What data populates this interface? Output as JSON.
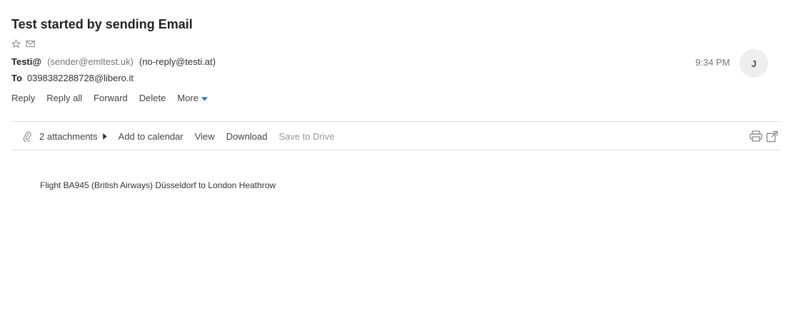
{
  "subject": "Test started by sending Email",
  "icons": {
    "star": "star-icon",
    "envelope": "envelope-icon",
    "chevron": "chevron-down-icon",
    "paperclip": "paperclip-icon",
    "triangle": "caret-right-icon",
    "print": "print-icon",
    "popout": "external-link-icon"
  },
  "from": {
    "name": "Testi@",
    "address": "(sender@emltest.uk)",
    "reply_to": "(no-reply@testi.at)"
  },
  "to": {
    "label": "To",
    "address": "0398382288728@libero.it"
  },
  "time": "9:34 PM",
  "avatar_initial": "J",
  "actions": {
    "reply": "Reply",
    "reply_all": "Reply all",
    "forward": "Forward",
    "delete": "Delete",
    "more": "More"
  },
  "attachments": {
    "count_label": "2 attachments",
    "add_to_calendar": "Add to calendar",
    "view": "View",
    "download": "Download",
    "save_to_drive": "Save to Drive"
  },
  "body": "Flight BA945 (British Airways) Düsseldorf to London Heathrow",
  "colors": {
    "accent": "#2f7cc4",
    "muted": "#999999",
    "divider": "#dddddd"
  }
}
